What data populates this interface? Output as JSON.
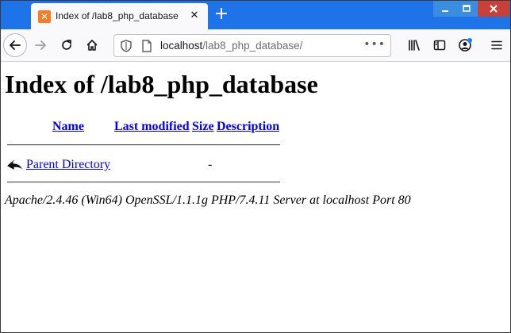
{
  "browser": {
    "tab": {
      "title": "Index of /lab8_php_database",
      "favicon": "xampp-icon"
    },
    "url": {
      "host": "localhost",
      "path": "/lab8_php_database/"
    },
    "colors": {
      "tabstrip": "#1e73e8",
      "close_button": "#c7403a",
      "link": "#0000ee"
    }
  },
  "page": {
    "heading": "Index of /lab8_php_database",
    "table": {
      "columns": [
        "Name",
        "Last modified",
        "Size",
        "Description"
      ],
      "rows": [
        {
          "icon": "back-arrow-icon",
          "name": "Parent Directory",
          "last_modified": "",
          "size": "-",
          "description": ""
        }
      ]
    },
    "footer": "Apache/2.4.46 (Win64) OpenSSL/1.1.1g PHP/7.4.11 Server at localhost Port 80"
  }
}
